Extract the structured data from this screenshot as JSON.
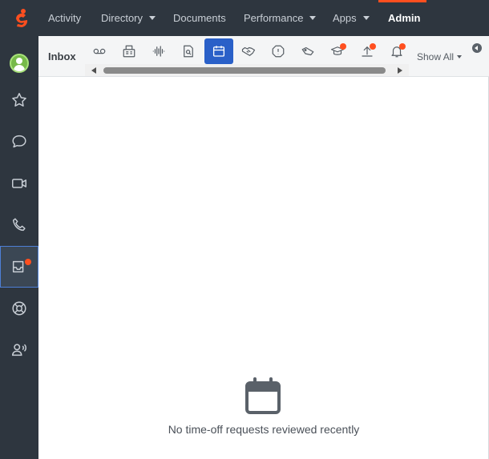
{
  "nav": {
    "items": [
      {
        "label": "Activity",
        "has_caret": false
      },
      {
        "label": "Directory",
        "has_caret": true
      },
      {
        "label": "Documents",
        "has_caret": false
      },
      {
        "label": "Performance",
        "has_caret": true
      },
      {
        "label": "Apps",
        "has_caret": true
      },
      {
        "label": "Admin",
        "has_caret": false,
        "active": true
      }
    ],
    "brand_icon": "genesys-logo-icon",
    "accent_color": "#ff4f1f",
    "background_color": "#2e363f"
  },
  "sidebar": {
    "items": [
      {
        "icon": "user-avatar-icon",
        "status": "available"
      },
      {
        "icon": "star-icon"
      },
      {
        "icon": "chat-bubble-icon"
      },
      {
        "icon": "video-camera-icon"
      },
      {
        "icon": "phone-icon"
      },
      {
        "icon": "inbox-icon",
        "selected": true,
        "notification": true
      },
      {
        "icon": "lifebuoy-icon"
      },
      {
        "icon": "user-speaking-icon"
      }
    ]
  },
  "inbox": {
    "title": "Inbox",
    "filters": [
      {
        "icon": "voicemail-icon"
      },
      {
        "icon": "fax-icon"
      },
      {
        "icon": "audio-recording-icon"
      },
      {
        "icon": "document-search-icon"
      },
      {
        "icon": "calendar-icon",
        "selected": true
      },
      {
        "icon": "handshake-icon"
      },
      {
        "icon": "alert-octagon-icon"
      },
      {
        "icon": "tag-icon"
      },
      {
        "icon": "graduation-cap-icon",
        "notification": true
      },
      {
        "icon": "upload-icon",
        "notification": true
      },
      {
        "icon": "bell-icon",
        "notification": true
      }
    ],
    "show_all_label": "Show All",
    "selected_color": "#2a60c8"
  },
  "empty_state": {
    "icon": "calendar-icon",
    "message": "No time-off requests reviewed recently"
  }
}
